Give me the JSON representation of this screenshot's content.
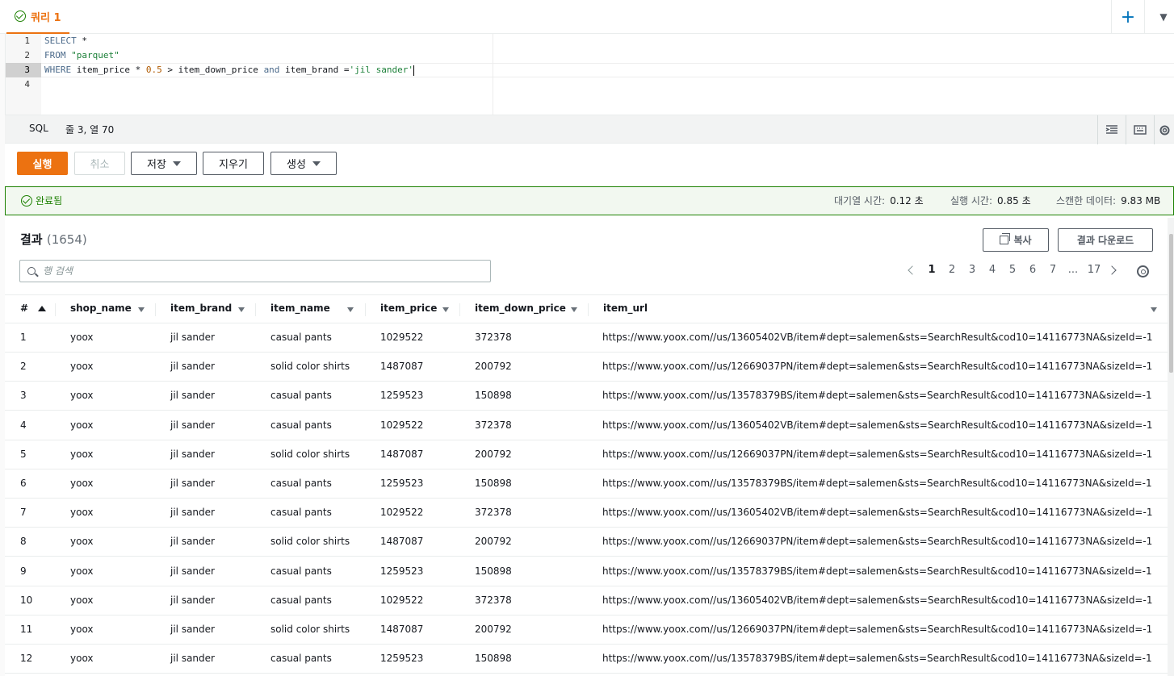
{
  "tab": {
    "title": "쿼리 1",
    "add_label": "+",
    "menu_label": "▼"
  },
  "editor": {
    "line_numbers": [
      "1",
      "2",
      "3",
      "4"
    ],
    "lines": {
      "l1_kw": "SELECT",
      "l1_rest": " *",
      "l2_kw": "FROM",
      "l2_str": " \"parquet\"",
      "l3_kw": "WHERE",
      "l3_a": " item_price * ",
      "l3_num": "0.5",
      "l3_b": " > item_down_price ",
      "l3_and": "and",
      "l3_c": " item_brand =",
      "l3_str": "'jil sander'"
    }
  },
  "statusbar": {
    "language": "SQL",
    "position": "줄 3, 열 70"
  },
  "actions": {
    "run": "실행",
    "cancel": "취소",
    "save": "저장",
    "clear": "지우기",
    "create": "생성"
  },
  "completion": {
    "status": "완료됨",
    "queue_label": "대기열 시간:",
    "queue_value": "0.12 초",
    "run_label": "실행 시간:",
    "run_value": "0.85 초",
    "scan_label": "스캔한 데이터:",
    "scan_value": "9.83 MB"
  },
  "results": {
    "title": "결과",
    "count": "(1654)",
    "copy_label": "복사",
    "download_label": "결과 다운로드",
    "search_placeholder": "행 검색",
    "pages": [
      "1",
      "2",
      "3",
      "4",
      "5",
      "6",
      "7",
      "...",
      "17"
    ],
    "current_page": "1"
  },
  "table": {
    "columns": [
      "#",
      "shop_name",
      "item_brand",
      "item_name",
      "item_price",
      "item_down_price",
      "item_url"
    ],
    "rows": [
      [
        "1",
        "yoox",
        "jil sander",
        "casual pants",
        "1029522",
        "372378",
        "https://www.yoox.com//us/13605402VB/item#dept=salemen&sts=SearchResult&cod10=14116773NA&sizeId=-1"
      ],
      [
        "2",
        "yoox",
        "jil sander",
        "solid color shirts",
        "1487087",
        "200792",
        "https://www.yoox.com//us/12669037PN/item#dept=salemen&sts=SearchResult&cod10=14116773NA&sizeId=-1"
      ],
      [
        "3",
        "yoox",
        "jil sander",
        "casual pants",
        "1259523",
        "150898",
        "https://www.yoox.com//us/13578379BS/item#dept=salemen&sts=SearchResult&cod10=14116773NA&sizeId=-1"
      ],
      [
        "4",
        "yoox",
        "jil sander",
        "casual pants",
        "1029522",
        "372378",
        "https://www.yoox.com//us/13605402VB/item#dept=salemen&sts=SearchResult&cod10=14116773NA&sizeId=-1"
      ],
      [
        "5",
        "yoox",
        "jil sander",
        "solid color shirts",
        "1487087",
        "200792",
        "https://www.yoox.com//us/12669037PN/item#dept=salemen&sts=SearchResult&cod10=14116773NA&sizeId=-1"
      ],
      [
        "6",
        "yoox",
        "jil sander",
        "casual pants",
        "1259523",
        "150898",
        "https://www.yoox.com//us/13578379BS/item#dept=salemen&sts=SearchResult&cod10=14116773NA&sizeId=-1"
      ],
      [
        "7",
        "yoox",
        "jil sander",
        "casual pants",
        "1029522",
        "372378",
        "https://www.yoox.com//us/13605402VB/item#dept=salemen&sts=SearchResult&cod10=14116773NA&sizeId=-1"
      ],
      [
        "8",
        "yoox",
        "jil sander",
        "solid color shirts",
        "1487087",
        "200792",
        "https://www.yoox.com//us/12669037PN/item#dept=salemen&sts=SearchResult&cod10=14116773NA&sizeId=-1"
      ],
      [
        "9",
        "yoox",
        "jil sander",
        "casual pants",
        "1259523",
        "150898",
        "https://www.yoox.com//us/13578379BS/item#dept=salemen&sts=SearchResult&cod10=14116773NA&sizeId=-1"
      ],
      [
        "10",
        "yoox",
        "jil sander",
        "casual pants",
        "1029522",
        "372378",
        "https://www.yoox.com//us/13605402VB/item#dept=salemen&sts=SearchResult&cod10=14116773NA&sizeId=-1"
      ],
      [
        "11",
        "yoox",
        "jil sander",
        "solid color shirts",
        "1487087",
        "200792",
        "https://www.yoox.com//us/12669037PN/item#dept=salemen&sts=SearchResult&cod10=14116773NA&sizeId=-1"
      ],
      [
        "12",
        "yoox",
        "jil sander",
        "casual pants",
        "1259523",
        "150898",
        "https://www.yoox.com//us/13578379BS/item#dept=salemen&sts=SearchResult&cod10=14116773NA&sizeId=-1"
      ]
    ]
  },
  "colors": {
    "accent": "#ec7211",
    "success": "#1d8102",
    "link": "#0073bb"
  },
  "icons": [
    "check-circle-icon",
    "plus-icon",
    "chevron-down-icon",
    "format-icon",
    "keyboard-icon",
    "settings-icon",
    "copy-icon",
    "search-icon",
    "chevron-left-icon",
    "chevron-right-icon",
    "sort-asc-icon",
    "filter-caret-icon"
  ]
}
